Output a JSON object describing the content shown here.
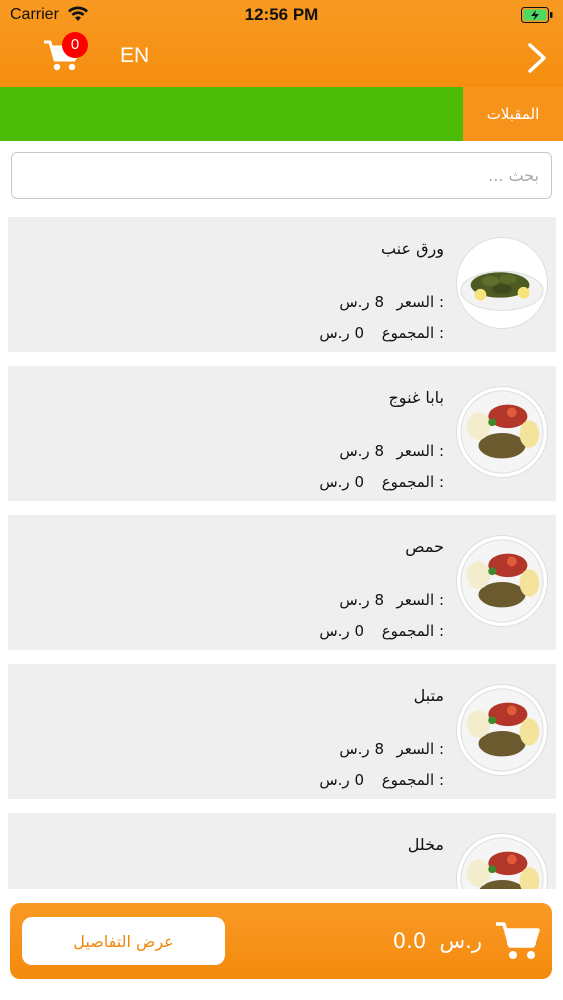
{
  "status_bar": {
    "carrier": "Carrier",
    "time": "12:56 PM"
  },
  "nav": {
    "cart_count": "0",
    "language_toggle": "EN"
  },
  "categories": {
    "active": "المقبلات"
  },
  "search": {
    "placeholder": "بحث ..."
  },
  "labels": {
    "price": "السعر :",
    "total": "المجموع :",
    "currency": "ر.س"
  },
  "items": [
    {
      "name": "ورق عنب",
      "price": "8",
      "total": "0",
      "image": "stuffed-grape-leaves"
    },
    {
      "name": "بابا غنوج",
      "price": "8",
      "total": "0",
      "image": "appetizer-platter"
    },
    {
      "name": "حمص",
      "price": "8",
      "total": "0",
      "image": "appetizer-platter"
    },
    {
      "name": "متبل",
      "price": "8",
      "total": "0",
      "image": "appetizer-platter"
    },
    {
      "name": "مخلل",
      "image": "appetizer-platter"
    }
  ],
  "bottom_bar": {
    "details_label": "عرض التفاصيل",
    "total_amount": "0.0",
    "currency": "ر.س"
  },
  "colors": {
    "primary_orange": "#f7921a",
    "category_green": "#4cbb06",
    "badge_red": "#ff0000",
    "card_bg": "#efefef"
  },
  "icons": [
    "wifi-icon",
    "battery-icon",
    "cart-icon",
    "chevron-right-icon"
  ]
}
